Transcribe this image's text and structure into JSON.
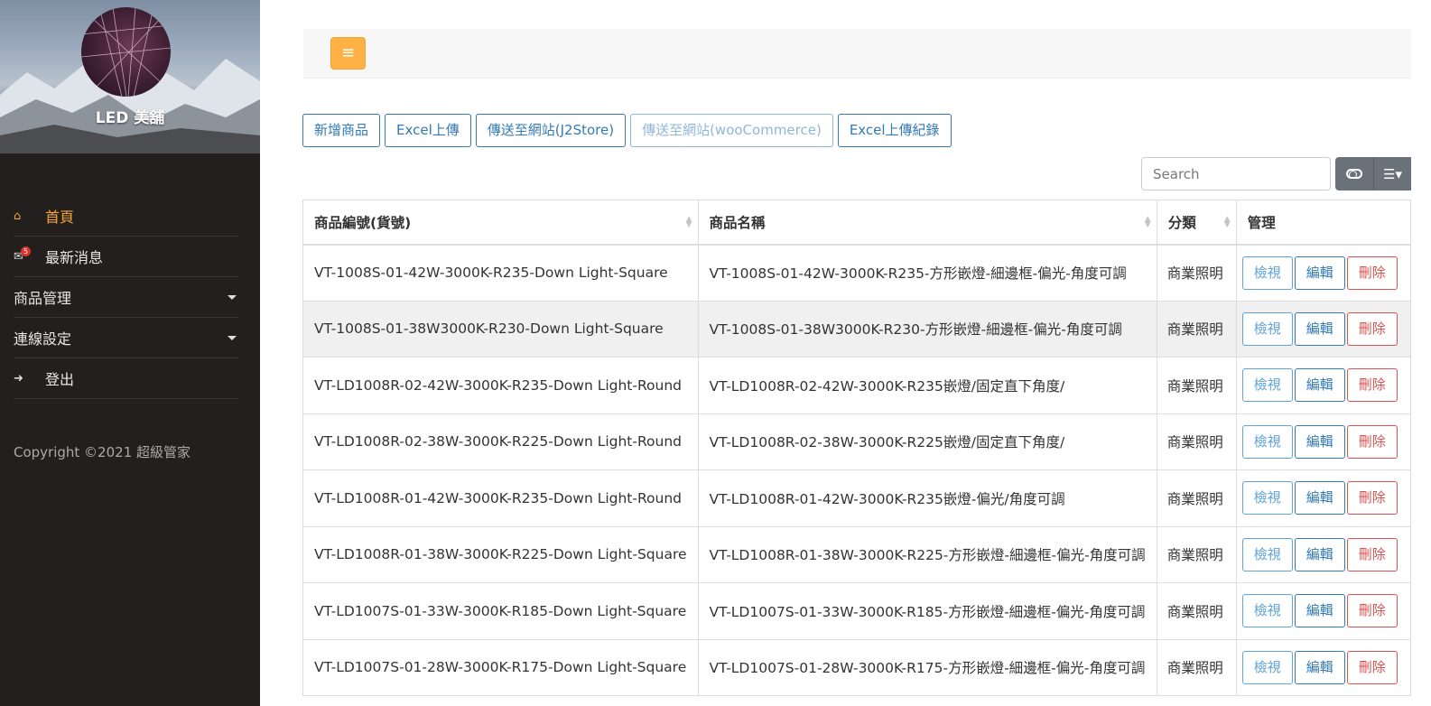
{
  "sidebar": {
    "brand": "LED 美舖",
    "nav": [
      {
        "label": "首頁",
        "icon": "home-icon",
        "active": true
      },
      {
        "label": "最新消息",
        "icon": "news-icon",
        "badge": "5"
      },
      {
        "label": "商品管理",
        "dropdown": true
      },
      {
        "label": "連線設定",
        "dropdown": true
      },
      {
        "label": "登出",
        "icon": "logout-icon"
      }
    ],
    "copyright": "Copyright ©2021 超級管家"
  },
  "topbar": {
    "menu_icon": "≡"
  },
  "toolbar": {
    "add": "新增商品",
    "excel_upload": "Excel上傳",
    "send_j2store": "傳送至網站(J2Store)",
    "send_woo": "傳送至網站(wooCommerce)",
    "excel_log": "Excel上傳紀錄"
  },
  "search": {
    "placeholder": "Search"
  },
  "table": {
    "headers": [
      "商品編號(貨號)",
      "商品名稱",
      "分類",
      "管理"
    ],
    "actions": {
      "view": "檢視",
      "edit": "編輯",
      "delete": "刪除"
    },
    "rows": [
      {
        "sku": "VT-1008S-01-42W-3000K-R235-Down Light-Square",
        "name": "VT-1008S-01-42W-3000K-R235-方形嵌燈-細邊框-偏光-角度可調",
        "category": "商業照明"
      },
      {
        "sku": "VT-1008S-01-38W3000K-R230-Down Light-Square",
        "name": "VT-1008S-01-38W3000K-R230-方形嵌燈-細邊框-偏光-角度可調",
        "category": "商業照明"
      },
      {
        "sku": "VT-LD1008R-02-42W-3000K-R235-Down Light-Round",
        "name": "VT-LD1008R-02-42W-3000K-R235嵌燈/固定直下角度/",
        "category": "商業照明"
      },
      {
        "sku": "VT-LD1008R-02-38W-3000K-R225-Down Light-Round",
        "name": "VT-LD1008R-02-38W-3000K-R225嵌燈/固定直下角度/",
        "category": "商業照明"
      },
      {
        "sku": "VT-LD1008R-01-42W-3000K-R235-Down Light-Round",
        "name": "VT-LD1008R-01-42W-3000K-R235嵌燈-偏光/角度可調",
        "category": "商業照明"
      },
      {
        "sku": "VT-LD1008R-01-38W-3000K-R225-Down Light-Square",
        "name": "VT-LD1008R-01-38W-3000K-R225-方形嵌燈-細邊框-偏光-角度可調",
        "category": "商業照明"
      },
      {
        "sku": "VT-LD1007S-01-33W-3000K-R185-Down Light-Square",
        "name": "VT-LD1007S-01-33W-3000K-R185-方形嵌燈-細邊框-偏光-角度可調",
        "category": "商業照明"
      },
      {
        "sku": "VT-LD1007S-01-28W-3000K-R175-Down Light-Square",
        "name": "VT-LD1007S-01-28W-3000K-R175-方形嵌燈-細邊框-偏光-角度可調",
        "category": "商業照明"
      }
    ]
  }
}
